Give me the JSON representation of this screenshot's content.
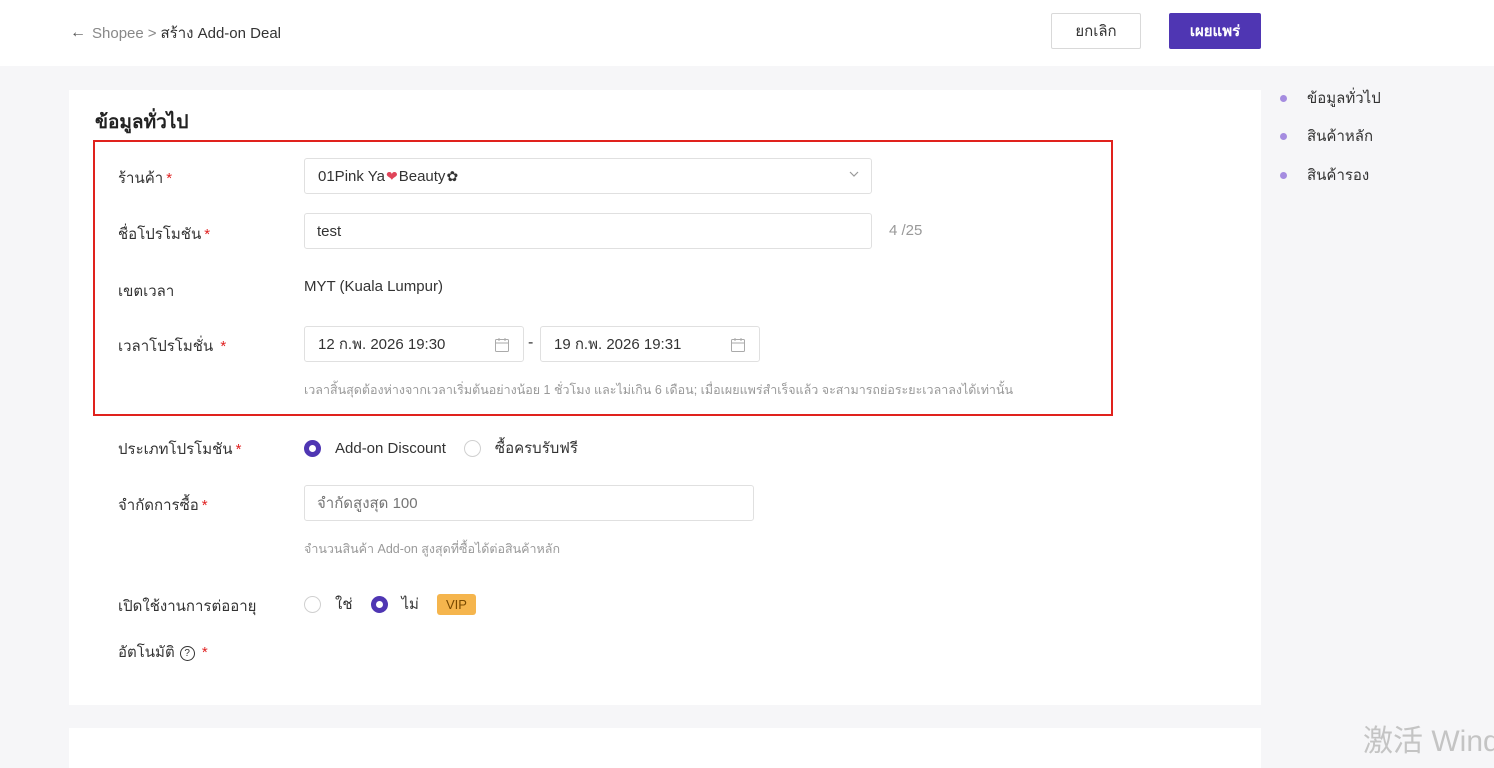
{
  "header": {
    "back_icon": "←",
    "breadcrumb_root": "Shopee",
    "breadcrumb_sep": ">",
    "breadcrumb_current": "สร้าง Add-on Deal",
    "cancel_label": "ยกเลิก",
    "publish_label": "เผยแพร่"
  },
  "section": {
    "title": "ข้อมูลทั่วไป"
  },
  "form": {
    "shop": {
      "label": "ร้านค้า",
      "required": "*",
      "value_prefix": "01Pink Ya",
      "value_heart": "❤",
      "value_suffix": "Beauty",
      "value_flower": "✿"
    },
    "promo_name": {
      "label": "ชื่อโปรโมชัน",
      "required": "*",
      "value": "test",
      "counter": "4 /25"
    },
    "timezone": {
      "label": "เขตเวลา",
      "value": "MYT (Kuala Lumpur)"
    },
    "promo_time": {
      "label": "เวลาโปรโมชั่น",
      "required": "*",
      "start": "12 ก.พ. 2026 19:30",
      "end": "19 ก.พ. 2026 19:31",
      "dash": "-",
      "hint": "เวลาสิ้นสุดต้องห่างจากเวลาเริ่มต้นอย่างน้อย 1 ชั่วโมง และไม่เกิน 6 เดือน; เมื่อเผยแพร่สำเร็จแล้ว จะสามารถย่อระยะเวลาลงได้เท่านั้น"
    },
    "promo_type": {
      "label": "ประเภทโปรโมชัน",
      "required": "*",
      "options": [
        "Add-on Discount",
        "ซื้อครบรับฟรี"
      ],
      "selected": "Add-on Discount"
    },
    "purchase_limit": {
      "label": "จำกัดการซื้อ",
      "required": "*",
      "placeholder": "จำกัดสูงสุด 100",
      "hint": "จำนวนสินค้า Add-on สูงสุดที่ซื้อได้ต่อสินค้าหลัก"
    },
    "auto_renew": {
      "label_line1": "เปิดใช้งานการต่ออายุ",
      "label_line2": "อัตโนมัติ",
      "required": "*",
      "help_icon": "?",
      "options": [
        "ใช่",
        "ไม่"
      ],
      "selected": "ไม่",
      "badge": "VIP"
    }
  },
  "side_nav": {
    "items": [
      "ข้อมูลทั่วไป",
      "สินค้าหลัก",
      "สินค้ารอง"
    ]
  },
  "watermark": "激活 Wind",
  "colors": {
    "primary": "#4f36b3",
    "highlight_border": "#e0221d",
    "required": "#e02020",
    "vip": "#f5b54d"
  }
}
